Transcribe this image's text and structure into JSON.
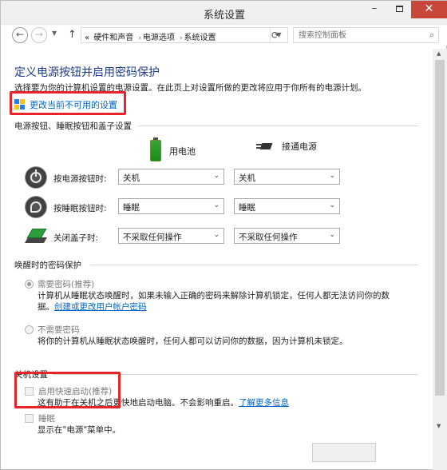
{
  "window": {
    "title": "系统设置",
    "controls": {
      "minimize": "–",
      "close": "✕"
    }
  },
  "nav": {
    "breadcrumbs": [
      "硬件和声音",
      "电源选项",
      "系统设置"
    ],
    "breadcrumb_prefix": "«",
    "search_placeholder": "搜索控制面板"
  },
  "page": {
    "title": "定义电源按钮并启用密码保护",
    "description": "选择要为你的计算机设置的电源设置。在此页上对设置所做的更改将应用于你所有的电源计划。",
    "change_link": "更改当前不可用的设置"
  },
  "power_section": {
    "heading": "电源按钮、睡眠按钮和盖子设置",
    "columns": {
      "battery": "用电池",
      "plugged": "接通电源"
    },
    "rows": [
      {
        "label": "按电源按钮时:",
        "battery": "关机",
        "plugged": "关机"
      },
      {
        "label": "按睡眠按钮时:",
        "battery": "睡眠",
        "plugged": "睡眠"
      },
      {
        "label": "关闭盖子时:",
        "battery": "不采取任何操作",
        "plugged": "不采取任何操作"
      }
    ]
  },
  "password_section": {
    "heading": "唤醒时的密码保护",
    "require": {
      "label": "需要密码(推荐)",
      "desc_line1": "计算机从睡眠状态唤醒时，如果未输入正确的密码来解除计算机锁定，任何人都无法访问你的数",
      "desc_line2_prefix": "据。",
      "link": "创建或更改用户帐户密码"
    },
    "none": {
      "label": "不需要密码",
      "desc": "将你的计算机从睡眠状态唤醒时，任何人都可以访问你的数据，因为计算机未锁定。"
    }
  },
  "shutdown_section": {
    "heading": "关机设置",
    "fast_startup": {
      "label": "启用快速启动(推荐)",
      "desc": "这有助于在关机之后更快地启动电脑。不会影响重启。",
      "link": "了解更多信息"
    },
    "sleep": {
      "label": "睡眠",
      "desc": "显示在\"电源\"菜单中。"
    }
  }
}
